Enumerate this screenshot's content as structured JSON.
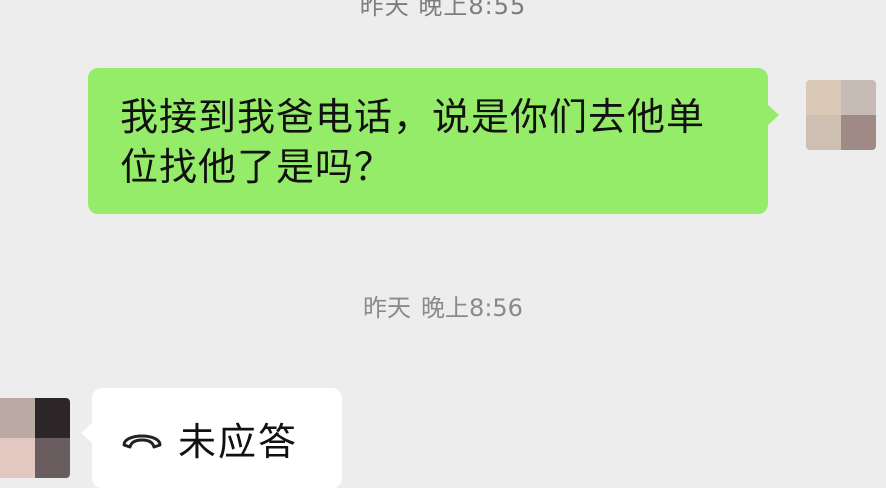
{
  "top_timestamp": "昨天 晚上8:55",
  "messages": {
    "outgoing_text": "我接到我爸电话，说是你们去他单位找他了是吗？",
    "timestamp_day": "昨天",
    "timestamp_time": "晚上8:56",
    "incoming_call_label": "未应答"
  },
  "icons": {
    "call": "phone-hangup-icon",
    "avatar_me": "avatar-pixelated",
    "avatar_them": "avatar-pixelated"
  },
  "colors": {
    "bubble_outgoing": "#95ec69",
    "bubble_incoming": "#ffffff",
    "background": "#ededed"
  }
}
